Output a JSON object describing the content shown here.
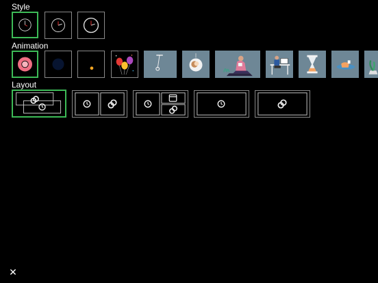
{
  "sections": {
    "style": "Style",
    "animation": "Animation",
    "layout": "Layout"
  },
  "style_options": [
    {
      "icon": "analog-clock-icon",
      "selected": true
    },
    {
      "icon": "analog-clock-icon",
      "selected": false
    },
    {
      "icon": "analog-clock-icon",
      "selected": false
    }
  ],
  "animation_options": [
    {
      "icon": "pink-donut-ring-icon",
      "selected": true
    },
    {
      "icon": "dark-blue-blob-icon",
      "selected": false
    },
    {
      "icon": "orange-dot-icon",
      "selected": false
    },
    {
      "icon": "balloons-icon",
      "selected": false
    },
    {
      "icon": "pendulum-icon",
      "selected": false
    },
    {
      "icon": "face-circle-icon",
      "selected": false
    },
    {
      "icon": "person-reading-icon",
      "selected": false
    },
    {
      "icon": "person-at-desk-icon",
      "selected": false
    },
    {
      "icon": "hourglass-icon",
      "selected": false
    },
    {
      "icon": "coffee-cup-icon",
      "selected": false
    },
    {
      "icon": "plant-icon",
      "selected": false
    }
  ],
  "layout_options": [
    {
      "icon": "overlap-rings-clock-layout-icon",
      "selected": true
    },
    {
      "icon": "clock-rings-split-layout-icon",
      "selected": false
    },
    {
      "icon": "clock-calendar-rings-layout-icon",
      "selected": false
    },
    {
      "icon": "clock-only-layout-icon",
      "selected": false
    },
    {
      "icon": "rings-only-layout-icon",
      "selected": false
    }
  ],
  "close_label": "✕",
  "colors": {
    "accent": "#3dbb57",
    "tile_border": "#8a8a8a",
    "tile_gray": "#6e8796",
    "background": "#000000"
  }
}
